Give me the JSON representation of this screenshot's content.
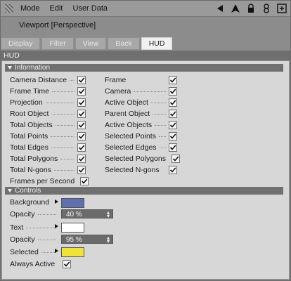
{
  "menubar": {
    "items": [
      "Mode",
      "Edit",
      "User Data"
    ]
  },
  "title": "Viewport [Perspective]",
  "tabs": [
    {
      "label": "Display",
      "active": false
    },
    {
      "label": "Filter",
      "active": false
    },
    {
      "label": "View",
      "active": false
    },
    {
      "label": "Back",
      "active": false
    },
    {
      "label": "HUD",
      "active": true
    }
  ],
  "section": {
    "label": "HUD"
  },
  "information": {
    "header": "Information",
    "left": [
      {
        "label": "Camera Distance",
        "checked": true
      },
      {
        "label": "Frame Time",
        "checked": true
      },
      {
        "label": "Projection",
        "checked": true
      },
      {
        "label": "Root Object",
        "checked": true
      },
      {
        "label": "Total Objects",
        "checked": true
      },
      {
        "label": "Total Points",
        "checked": true
      },
      {
        "label": "Total Edges",
        "checked": true
      },
      {
        "label": "Total Polygons",
        "checked": true
      },
      {
        "label": "Total N-gons",
        "checked": true
      },
      {
        "label": "Frames per Second",
        "checked": true
      }
    ],
    "right": [
      {
        "label": "Frame",
        "checked": true
      },
      {
        "label": "Camera",
        "checked": true
      },
      {
        "label": "Active Object",
        "checked": true
      },
      {
        "label": "Parent Object",
        "checked": true
      },
      {
        "label": "Active Objects",
        "checked": true
      },
      {
        "label": "Selected Points",
        "checked": true
      },
      {
        "label": "Selected Edges",
        "checked": true
      },
      {
        "label": "Selected Polygons",
        "checked": true
      },
      {
        "label": "Selected N-gons",
        "checked": true
      }
    ]
  },
  "controls": {
    "header": "Controls",
    "background": {
      "label": "Background",
      "color": "#5f6fb0"
    },
    "opacity1": {
      "label": "Opacity",
      "value": "40 %"
    },
    "text": {
      "label": "Text",
      "color": "#ffffff"
    },
    "opacity2": {
      "label": "Opacity",
      "value": "95 %"
    },
    "selected": {
      "label": "Selected",
      "color": "#efe23a"
    },
    "always_active": {
      "label": "Always Active",
      "checked": true
    }
  }
}
